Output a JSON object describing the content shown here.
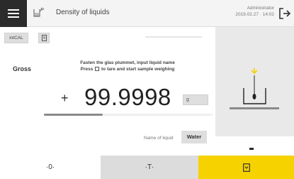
{
  "header": {
    "title": "Density of liquids",
    "app_icon_label": "P",
    "user": "Administrator",
    "datetime": "2019.02.27 · 14:02"
  },
  "toolbar": {
    "cal_label": "intCAL"
  },
  "main": {
    "mode_label": "Gross",
    "instruction_line1": "Fasten the glas plummet, input liquid name",
    "instruction_press": "Press",
    "instruction_rest": "to tare and start sample weighing",
    "sign": "+",
    "weight": "99.9998",
    "unit": "g",
    "weigh_progress": 0.35
  },
  "liquid": {
    "label": "Name of liquid",
    "value": "Water"
  },
  "bottom": {
    "zero_label": "·0·",
    "tare_label": "·T·"
  },
  "colors": {
    "accent": "#f5d200",
    "menu_bg": "#2b2b2b"
  },
  "icons": {
    "menu": "hamburger-icon",
    "logout": "logout-icon",
    "print": "print-icon",
    "document": "document-icon"
  }
}
